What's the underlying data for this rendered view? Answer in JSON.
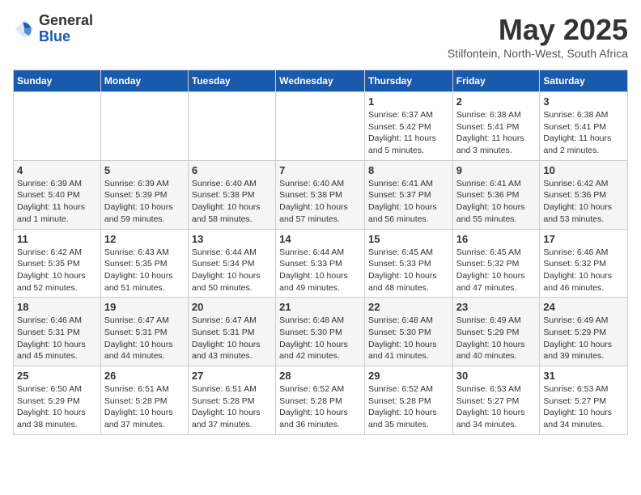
{
  "logo": {
    "general": "General",
    "blue": "Blue"
  },
  "title": "May 2025",
  "subtitle": "Stilfontein, North-West, South Africa",
  "days_of_week": [
    "Sunday",
    "Monday",
    "Tuesday",
    "Wednesday",
    "Thursday",
    "Friday",
    "Saturday"
  ],
  "weeks": [
    [
      {
        "day": "",
        "sunrise": "",
        "sunset": "",
        "daylight": ""
      },
      {
        "day": "",
        "sunrise": "",
        "sunset": "",
        "daylight": ""
      },
      {
        "day": "",
        "sunrise": "",
        "sunset": "",
        "daylight": ""
      },
      {
        "day": "",
        "sunrise": "",
        "sunset": "",
        "daylight": ""
      },
      {
        "day": "1",
        "sunrise": "Sunrise: 6:37 AM",
        "sunset": "Sunset: 5:42 PM",
        "daylight": "Daylight: 11 hours and 5 minutes."
      },
      {
        "day": "2",
        "sunrise": "Sunrise: 6:38 AM",
        "sunset": "Sunset: 5:41 PM",
        "daylight": "Daylight: 11 hours and 3 minutes."
      },
      {
        "day": "3",
        "sunrise": "Sunrise: 6:38 AM",
        "sunset": "Sunset: 5:41 PM",
        "daylight": "Daylight: 11 hours and 2 minutes."
      }
    ],
    [
      {
        "day": "4",
        "sunrise": "Sunrise: 6:39 AM",
        "sunset": "Sunset: 5:40 PM",
        "daylight": "Daylight: 11 hours and 1 minute."
      },
      {
        "day": "5",
        "sunrise": "Sunrise: 6:39 AM",
        "sunset": "Sunset: 5:39 PM",
        "daylight": "Daylight: 10 hours and 59 minutes."
      },
      {
        "day": "6",
        "sunrise": "Sunrise: 6:40 AM",
        "sunset": "Sunset: 5:38 PM",
        "daylight": "Daylight: 10 hours and 58 minutes."
      },
      {
        "day": "7",
        "sunrise": "Sunrise: 6:40 AM",
        "sunset": "Sunset: 5:38 PM",
        "daylight": "Daylight: 10 hours and 57 minutes."
      },
      {
        "day": "8",
        "sunrise": "Sunrise: 6:41 AM",
        "sunset": "Sunset: 5:37 PM",
        "daylight": "Daylight: 10 hours and 56 minutes."
      },
      {
        "day": "9",
        "sunrise": "Sunrise: 6:41 AM",
        "sunset": "Sunset: 5:36 PM",
        "daylight": "Daylight: 10 hours and 55 minutes."
      },
      {
        "day": "10",
        "sunrise": "Sunrise: 6:42 AM",
        "sunset": "Sunset: 5:36 PM",
        "daylight": "Daylight: 10 hours and 53 minutes."
      }
    ],
    [
      {
        "day": "11",
        "sunrise": "Sunrise: 6:42 AM",
        "sunset": "Sunset: 5:35 PM",
        "daylight": "Daylight: 10 hours and 52 minutes."
      },
      {
        "day": "12",
        "sunrise": "Sunrise: 6:43 AM",
        "sunset": "Sunset: 5:35 PM",
        "daylight": "Daylight: 10 hours and 51 minutes."
      },
      {
        "day": "13",
        "sunrise": "Sunrise: 6:44 AM",
        "sunset": "Sunset: 5:34 PM",
        "daylight": "Daylight: 10 hours and 50 minutes."
      },
      {
        "day": "14",
        "sunrise": "Sunrise: 6:44 AM",
        "sunset": "Sunset: 5:33 PM",
        "daylight": "Daylight: 10 hours and 49 minutes."
      },
      {
        "day": "15",
        "sunrise": "Sunrise: 6:45 AM",
        "sunset": "Sunset: 5:33 PM",
        "daylight": "Daylight: 10 hours and 48 minutes."
      },
      {
        "day": "16",
        "sunrise": "Sunrise: 6:45 AM",
        "sunset": "Sunset: 5:32 PM",
        "daylight": "Daylight: 10 hours and 47 minutes."
      },
      {
        "day": "17",
        "sunrise": "Sunrise: 6:46 AM",
        "sunset": "Sunset: 5:32 PM",
        "daylight": "Daylight: 10 hours and 46 minutes."
      }
    ],
    [
      {
        "day": "18",
        "sunrise": "Sunrise: 6:46 AM",
        "sunset": "Sunset: 5:31 PM",
        "daylight": "Daylight: 10 hours and 45 minutes."
      },
      {
        "day": "19",
        "sunrise": "Sunrise: 6:47 AM",
        "sunset": "Sunset: 5:31 PM",
        "daylight": "Daylight: 10 hours and 44 minutes."
      },
      {
        "day": "20",
        "sunrise": "Sunrise: 6:47 AM",
        "sunset": "Sunset: 5:31 PM",
        "daylight": "Daylight: 10 hours and 43 minutes."
      },
      {
        "day": "21",
        "sunrise": "Sunrise: 6:48 AM",
        "sunset": "Sunset: 5:30 PM",
        "daylight": "Daylight: 10 hours and 42 minutes."
      },
      {
        "day": "22",
        "sunrise": "Sunrise: 6:48 AM",
        "sunset": "Sunset: 5:30 PM",
        "daylight": "Daylight: 10 hours and 41 minutes."
      },
      {
        "day": "23",
        "sunrise": "Sunrise: 6:49 AM",
        "sunset": "Sunset: 5:29 PM",
        "daylight": "Daylight: 10 hours and 40 minutes."
      },
      {
        "day": "24",
        "sunrise": "Sunrise: 6:49 AM",
        "sunset": "Sunset: 5:29 PM",
        "daylight": "Daylight: 10 hours and 39 minutes."
      }
    ],
    [
      {
        "day": "25",
        "sunrise": "Sunrise: 6:50 AM",
        "sunset": "Sunset: 5:29 PM",
        "daylight": "Daylight: 10 hours and 38 minutes."
      },
      {
        "day": "26",
        "sunrise": "Sunrise: 6:51 AM",
        "sunset": "Sunset: 5:28 PM",
        "daylight": "Daylight: 10 hours and 37 minutes."
      },
      {
        "day": "27",
        "sunrise": "Sunrise: 6:51 AM",
        "sunset": "Sunset: 5:28 PM",
        "daylight": "Daylight: 10 hours and 37 minutes."
      },
      {
        "day": "28",
        "sunrise": "Sunrise: 6:52 AM",
        "sunset": "Sunset: 5:28 PM",
        "daylight": "Daylight: 10 hours and 36 minutes."
      },
      {
        "day": "29",
        "sunrise": "Sunrise: 6:52 AM",
        "sunset": "Sunset: 5:28 PM",
        "daylight": "Daylight: 10 hours and 35 minutes."
      },
      {
        "day": "30",
        "sunrise": "Sunrise: 6:53 AM",
        "sunset": "Sunset: 5:27 PM",
        "daylight": "Daylight: 10 hours and 34 minutes."
      },
      {
        "day": "31",
        "sunrise": "Sunrise: 6:53 AM",
        "sunset": "Sunset: 5:27 PM",
        "daylight": "Daylight: 10 hours and 34 minutes."
      }
    ]
  ]
}
